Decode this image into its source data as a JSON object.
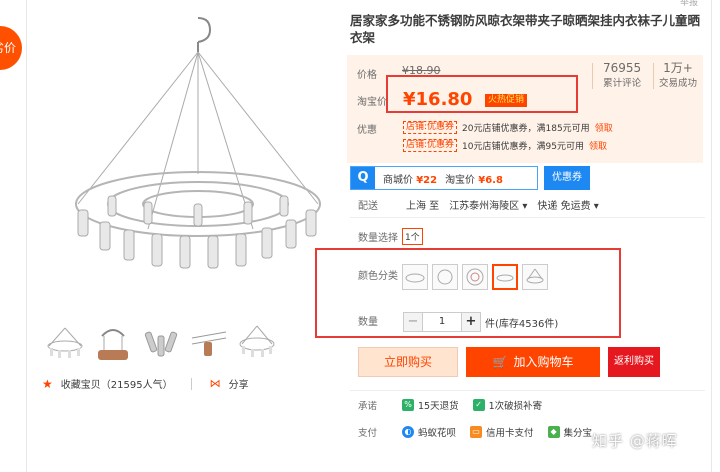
{
  "promo_badge": "劣价",
  "report_link": "举报",
  "title": "居家家多功能不锈钢防风晾衣架带夹子晾晒架挂内衣袜子儿童晒衣架",
  "price": {
    "label": "价格",
    "original": "¥18.90",
    "taobao_label": "淘宝价",
    "current": "¥16.80",
    "hot_tag": "火热促销"
  },
  "stats": [
    {
      "value": "76955",
      "label": "累计评论"
    },
    {
      "value": "1万+",
      "label": "交易成功"
    }
  ],
  "coupons": {
    "label": "优惠",
    "items": [
      {
        "tag": "店铺:优惠券",
        "text": "20元店铺优惠券，满185元可用",
        "action": "领取"
      },
      {
        "tag": "店铺:优惠券",
        "text": "10元店铺优惠券，满95元可用",
        "action": "领取"
      }
    ]
  },
  "compare": {
    "logo": "Q",
    "mall_label": "商城价",
    "mall_price": "¥22",
    "taobao_label": "淘宝价",
    "taobao_price": "¥6.8",
    "coupon_button": "优惠券"
  },
  "delivery": {
    "label": "配送",
    "from": "上海 至",
    "to": "江苏泰州海陵区 ▾",
    "method": "快递 免运费 ▾"
  },
  "quantity_select": {
    "label": "数量选择",
    "option": "1个"
  },
  "color": {
    "label": "颜色分类"
  },
  "quantity": {
    "label": "数量",
    "value": "1",
    "minus": "−",
    "plus": "+",
    "stock": "件(库存4536件)"
  },
  "buttons": {
    "buy_now": "立即购买",
    "add_cart": "加入购物车",
    "cashback": "返利购买"
  },
  "favorite": {
    "text": "收藏宝贝（21595人气）"
  },
  "share": {
    "text": "分享"
  },
  "promise": {
    "label": "承诺",
    "items": [
      "15天退货",
      "1次破损补寄"
    ]
  },
  "payment": {
    "label": "支付",
    "items": [
      "蚂蚁花呗",
      "信用卡支付",
      "集分宝"
    ]
  },
  "watermark": "知乎 @蒋晖",
  "colors": {
    "accent": "#ff4400",
    "blue": "#1e88f2",
    "highlight_box": "#e53c35"
  }
}
